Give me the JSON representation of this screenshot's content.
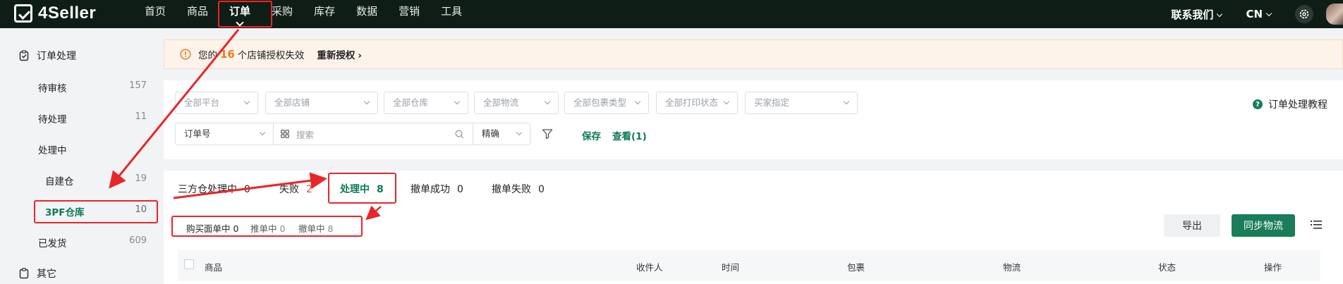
{
  "brand": {
    "name": "4Seller"
  },
  "nav": {
    "items": [
      "首页",
      "商品",
      "订单",
      "采购",
      "库存",
      "数据",
      "营销",
      "工具"
    ],
    "active_index": 2
  },
  "topbar": {
    "contact": "联系我们",
    "language": "CN"
  },
  "sidebar": {
    "group_orders": "订单处理",
    "items": [
      {
        "label": "待审核",
        "count": "157"
      },
      {
        "label": "待处理",
        "count": "11"
      },
      {
        "label": "处理中",
        "count": ""
      },
      {
        "label": "自建仓",
        "count": "19"
      },
      {
        "label": "3PF仓库",
        "count": "10"
      },
      {
        "label": "已发货",
        "count": "609"
      }
    ],
    "group_other": "其它"
  },
  "alert": {
    "prefix": "您的",
    "count": "16",
    "suffix": "个店铺授权失效",
    "action": "重新授权"
  },
  "filters": {
    "platform": "全部平台",
    "store": "全部店铺",
    "warehouse": "全部仓库",
    "logistics": "全部物流",
    "package_type": "全部包裹类型",
    "print_status": "全部打印状态",
    "buyer_spec": "买家指定",
    "order_field": "订单号",
    "search_placeholder": "搜索",
    "match_mode": "精确",
    "save": "保存",
    "view": "查看(1)",
    "tutorial": "订单处理教程"
  },
  "tabs": [
    {
      "label": "三方仓处理中",
      "count": "0"
    },
    {
      "label": "失败",
      "count": "2"
    },
    {
      "label": "处理中",
      "count": "8"
    },
    {
      "label": "撤单成功",
      "count": "0"
    },
    {
      "label": "撤单失败",
      "count": "0"
    }
  ],
  "subtabs": [
    {
      "label": "购买面单中",
      "count": "0"
    },
    {
      "label": "推单中",
      "count": "0"
    },
    {
      "label": "撤单中",
      "count": "8"
    }
  ],
  "actions": {
    "export": "导出",
    "sync": "同步物流"
  },
  "table": {
    "columns": [
      "商品",
      "收件人",
      "时间",
      "包裹",
      "物流",
      "状态",
      "操作"
    ]
  },
  "colors": {
    "brand_green": "#1a7d5a",
    "annotation_red": "#e8262a",
    "warning_orange": "#f27a1a"
  }
}
